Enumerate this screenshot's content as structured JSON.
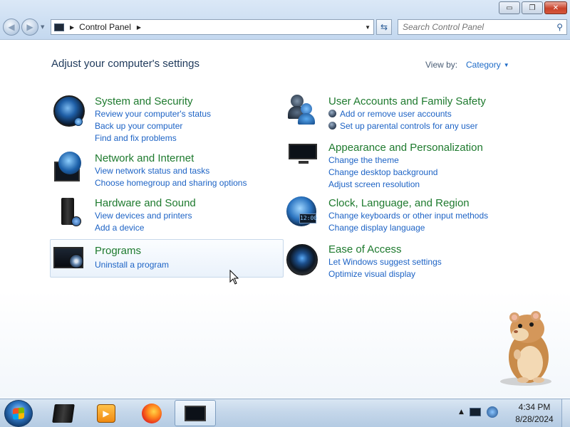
{
  "window": {
    "controls": {
      "minimize": "▭",
      "maximize": "❐",
      "close": "✕"
    }
  },
  "navigation": {
    "back_icon": "back-arrow-icon",
    "forward_icon": "forward-arrow-icon",
    "breadcrumb": "Control Panel",
    "search_placeholder": "Search Control Panel"
  },
  "main": {
    "heading": "Adjust your computer's settings",
    "view_by_label": "View by:",
    "view_by_value": "Category",
    "categories_left": [
      {
        "title": "System and Security",
        "icon": "shield-orb-icon",
        "links": [
          "Review your computer's status",
          "Back up your computer",
          "Find and fix problems"
        ]
      },
      {
        "title": "Network and Internet",
        "icon": "globe-network-icon",
        "links": [
          "View network status and tasks",
          "Choose homegroup and sharing options"
        ]
      },
      {
        "title": "Hardware and Sound",
        "icon": "printer-speaker-icon",
        "links": [
          "View devices and printers",
          "Add a device"
        ]
      },
      {
        "title": "Programs",
        "icon": "programs-disc-icon",
        "links": [
          "Uninstall a program"
        ]
      }
    ],
    "categories_right": [
      {
        "title": "User Accounts and Family Safety",
        "icon": "users-icon",
        "links": [
          "Add or remove user accounts",
          "Set up parental controls for any user"
        ]
      },
      {
        "title": "Appearance and Personalization",
        "icon": "monitor-icon",
        "links": [
          "Change the theme",
          "Change desktop background",
          "Adjust screen resolution"
        ]
      },
      {
        "title": "Clock, Language, and Region",
        "icon": "clock-globe-icon",
        "links": [
          "Change keyboards or other input methods",
          "Change display language"
        ]
      },
      {
        "title": "Ease of Access",
        "icon": "ease-of-access-icon",
        "links": [
          "Let Windows suggest settings",
          "Optimize visual display"
        ]
      }
    ]
  },
  "taskbar": {
    "pinned": [
      "computer-tower-icon",
      "media-player-icon",
      "firefox-icon",
      "control-panel-icon"
    ],
    "clock_time": "4:34 PM",
    "clock_date": "8/28/2024"
  }
}
